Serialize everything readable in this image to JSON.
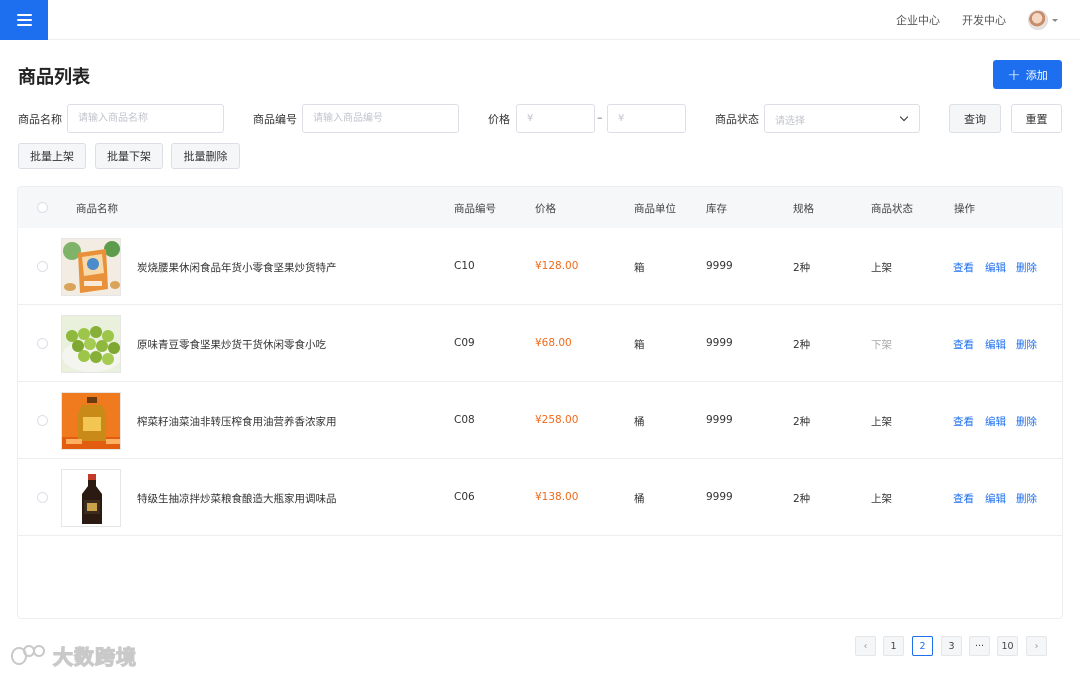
{
  "topbar": {
    "links": [
      "企业中心",
      "开发中心"
    ]
  },
  "page": {
    "title": "商品列表",
    "add_label": "添加"
  },
  "filters": {
    "name_label": "商品名称",
    "name_placeholder": "请输入商品名称",
    "code_label": "商品编号",
    "code_placeholder": "请输入商品编号",
    "price_label": "价格",
    "price_min_placeholder": "¥",
    "price_max_placeholder": "¥",
    "price_separator": "–",
    "status_label": "商品状态",
    "status_placeholder": "请选择",
    "query_label": "查询",
    "reset_label": "重置"
  },
  "bulk": {
    "on_shelf": "批量上架",
    "off_shelf": "批量下架",
    "delete": "批量删除"
  },
  "table": {
    "columns": [
      "商品名称",
      "商品编号",
      "价格",
      "商品单位",
      "库存",
      "规格",
      "商品状态",
      "操作"
    ],
    "actions": {
      "view": "查看",
      "edit": "编辑",
      "delete": "删除"
    },
    "rows": [
      {
        "name": "炭烧腰果休闲食品年货小零食坚果炒货特产",
        "code": "C10",
        "price": "¥128.00",
        "unit": "箱",
        "stock": "9999",
        "spec": "2种",
        "status": "上架",
        "thumb": "cashew-bag"
      },
      {
        "name": "原味青豆零食坚果炒货干货休闲零食小吃",
        "code": "C09",
        "price": "¥68.00",
        "unit": "箱",
        "stock": "9999",
        "spec": "2种",
        "status": "下架",
        "thumb": "green-peas"
      },
      {
        "name": "榨菜籽油菜油非转压榨食用油营养香浓家用",
        "code": "C08",
        "price": "¥258.00",
        "unit": "桶",
        "stock": "9999",
        "spec": "2种",
        "status": "上架",
        "thumb": "oil-bottle"
      },
      {
        "name": "特级生抽凉拌炒菜粮食酿造大瓶家用调味品",
        "code": "C06",
        "price": "¥138.00",
        "unit": "桶",
        "stock": "9999",
        "spec": "2种",
        "status": "上架",
        "thumb": "soy-sauce"
      }
    ]
  },
  "pagination": {
    "prev": "‹",
    "pages": [
      "1",
      "2",
      "3",
      "···",
      "10"
    ],
    "current": "2",
    "next": "›"
  },
  "watermark": {
    "text": "大数跨境"
  },
  "colors": {
    "primary": "#1e6ff0",
    "price": "#f06a1c"
  }
}
